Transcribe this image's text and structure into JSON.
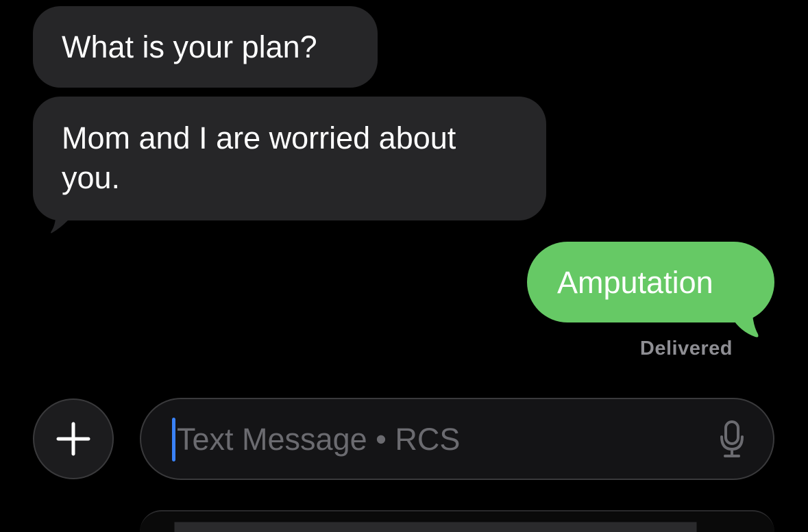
{
  "conversation": {
    "messages": [
      {
        "direction": "incoming",
        "text": "What is your plan?"
      },
      {
        "direction": "incoming",
        "text": "Mom and I are worried about you."
      },
      {
        "direction": "outgoing",
        "text": "Amputation"
      }
    ],
    "status": "Delivered"
  },
  "composer": {
    "placeholder": "Text Message • RCS",
    "add_icon": "plus-icon",
    "mic_icon": "microphone-icon"
  },
  "colors": {
    "background": "#000000",
    "incoming_bubble": "#262628",
    "outgoing_bubble": "#66c965",
    "caret": "#3a82f7",
    "status_text": "#8e8e93"
  }
}
